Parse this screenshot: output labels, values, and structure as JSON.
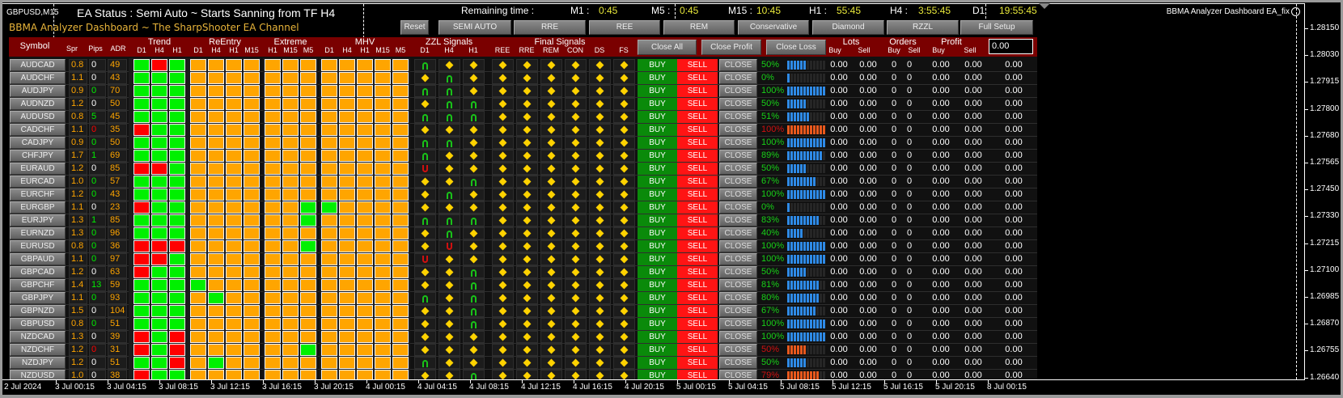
{
  "chart": {
    "symbol_tf": "GBPUSD,M15",
    "indicator_name": "BBMA Analyzer Dashboard EA_fix",
    "price_ticks": [
      "1.28150",
      "1.28030",
      "1.27915",
      "1.27800",
      "1.27680",
      "1.27565",
      "1.27450",
      "1.27330",
      "1.27215",
      "1.27100",
      "1.26985",
      "1.26870",
      "1.26755",
      "1.26640"
    ],
    "time_ticks": [
      "2 Jul 2024",
      "3 Jul 00:15",
      "3 Jul 04:15",
      "3 Jul 08:15",
      "3 Jul 12:15",
      "3 Jul 16:15",
      "3 Jul 20:15",
      "4 Jul 00:15",
      "4 Jul 04:15",
      "4 Jul 08:15",
      "4 Jul 12:15",
      "4 Jul 16:15",
      "4 Jul 20:15",
      "5 Jul 00:15",
      "5 Jul 04:15",
      "5 Jul 08:15",
      "5 Jul 12:15",
      "5 Jul 16:15",
      "5 Jul 20:15",
      "8 Jul 00:15"
    ]
  },
  "status": {
    "ea_status": "EA Status : Semi Auto ~ Starts Sanning from TF H4",
    "brand": "BBMA Analyzer Dashboard ~ The SharpShooter EA Channel"
  },
  "timer": {
    "label": "Remaining time :",
    "items": [
      {
        "tf": "M1 :",
        "value": "0:45"
      },
      {
        "tf": "M5 :",
        "value": "0:45"
      },
      {
        "tf": "M15 :",
        "value": "10:45"
      },
      {
        "tf": "H1 :",
        "value": "55:45"
      },
      {
        "tf": "H4 :",
        "value": "3:55:45"
      },
      {
        "tf": "D1",
        "value": "19:55:45"
      }
    ]
  },
  "mode_buttons": [
    "Reset",
    "SEMI AUTO",
    "RRE",
    "REE",
    "REM",
    "Conservative",
    "Diamond",
    "RZZL",
    "Full Setup"
  ],
  "columns": {
    "symbol": "Symbol",
    "spr": "Spr",
    "pips": "Pips",
    "adr": "ADR",
    "trend": {
      "label": "Trend",
      "sub": [
        "D1",
        "H4",
        "H1"
      ]
    },
    "reentry": {
      "label": "ReEntry",
      "sub": [
        "D1",
        "H4",
        "H1",
        "M15"
      ]
    },
    "extreme": {
      "label": "Extreme",
      "sub": [
        "H1",
        "M15",
        "M5"
      ]
    },
    "mhv": {
      "label": "MHV",
      "sub": [
        "D1",
        "H4",
        "H1",
        "M15",
        "M5"
      ]
    },
    "zzl": {
      "label": "ZZL Signals",
      "sub": [
        "D1",
        "H4",
        "H1"
      ]
    },
    "final": {
      "label": "Final Signals",
      "sub": [
        "REE",
        "RRE",
        "REM",
        "CON",
        "DS",
        "FS"
      ]
    },
    "lots": {
      "label": "Lots",
      "buy": "Buy",
      "sell": "Sell"
    },
    "orders": {
      "label": "Orders",
      "buy": "Buy",
      "sell": "Sell"
    },
    "profit": {
      "label": "Profit",
      "buy": "Buy",
      "sell": "Sell"
    }
  },
  "actions": {
    "close_all": "Close All",
    "close_profit": "Close Profit",
    "close_loss": "Close Loss"
  },
  "profit_total_input": "0.00",
  "row_buttons": {
    "buy": "BUY",
    "sell": "SELL",
    "close": "CLOSE"
  },
  "colors": {
    "header_bg": "#7a0000",
    "green": "#00f000",
    "red": "#ff0000",
    "orange": "#ffa500",
    "diamond": "#ffd200",
    "bar_blue": "#2e8ae6",
    "bar_orange": "#e8581c",
    "timer_value": "#e8e83a",
    "brand": "#e8b43a",
    "buy": "#0a8a0a",
    "sell": "#ff1414",
    "close": "#6c6c6c"
  },
  "rows": [
    {
      "symbol": "AUDCAD",
      "spr": "0.8",
      "pips": "0",
      "pips_color": "white",
      "adr": "49",
      "trend": [
        "green",
        "red",
        "green"
      ],
      "reentry": [
        "orange",
        "orange",
        "orange",
        "orange"
      ],
      "extreme": [
        "orange",
        "orange",
        "orange"
      ],
      "mhv": [
        "orange",
        "orange",
        "orange",
        "orange",
        "orange"
      ],
      "zzl": [
        "up",
        "diamond",
        "diamond"
      ],
      "pct": "50%",
      "pct_color": "green"
    },
    {
      "symbol": "AUDCHF",
      "spr": "1.1",
      "pips": "0",
      "pips_color": "white",
      "adr": "43",
      "trend": [
        "green",
        "green",
        "green"
      ],
      "reentry": [
        "orange",
        "orange",
        "orange",
        "orange"
      ],
      "extreme": [
        "orange",
        "orange",
        "orange"
      ],
      "mhv": [
        "orange",
        "orange",
        "orange",
        "orange",
        "orange"
      ],
      "zzl": [
        "diamond",
        "up",
        "diamond"
      ],
      "pct": "0%",
      "pct_color": "green"
    },
    {
      "symbol": "AUDJPY",
      "spr": "0.9",
      "pips": "0",
      "pips_color": "green",
      "adr": "70",
      "trend": [
        "green",
        "green",
        "green"
      ],
      "reentry": [
        "orange",
        "orange",
        "orange",
        "orange"
      ],
      "extreme": [
        "orange",
        "orange",
        "orange"
      ],
      "mhv": [
        "orange",
        "orange",
        "orange",
        "orange",
        "orange"
      ],
      "zzl": [
        "up",
        "up",
        "diamond"
      ],
      "pct": "100%",
      "pct_color": "green"
    },
    {
      "symbol": "AUDNZD",
      "spr": "1.2",
      "pips": "0",
      "pips_color": "white",
      "adr": "50",
      "trend": [
        "green",
        "green",
        "green"
      ],
      "reentry": [
        "orange",
        "orange",
        "orange",
        "orange"
      ],
      "extreme": [
        "orange",
        "orange",
        "orange"
      ],
      "mhv": [
        "orange",
        "orange",
        "orange",
        "orange",
        "orange"
      ],
      "zzl": [
        "diamond",
        "up",
        "up"
      ],
      "pct": "50%",
      "pct_color": "green"
    },
    {
      "symbol": "AUDUSD",
      "spr": "0.8",
      "pips": "5",
      "pips_color": "green",
      "adr": "45",
      "trend": [
        "green",
        "green",
        "green"
      ],
      "reentry": [
        "orange",
        "orange",
        "orange",
        "orange"
      ],
      "extreme": [
        "orange",
        "orange",
        "orange"
      ],
      "mhv": [
        "orange",
        "orange",
        "orange",
        "orange",
        "orange"
      ],
      "zzl": [
        "up",
        "up",
        "up"
      ],
      "pct": "51%",
      "pct_color": "green"
    },
    {
      "symbol": "CADCHF",
      "spr": "1.1",
      "pips": "0",
      "pips_color": "red",
      "adr": "35",
      "trend": [
        "red",
        "green",
        "green"
      ],
      "reentry": [
        "orange",
        "orange",
        "orange",
        "orange"
      ],
      "extreme": [
        "orange",
        "orange",
        "orange"
      ],
      "mhv": [
        "orange",
        "orange",
        "orange",
        "orange",
        "orange"
      ],
      "zzl": [
        "diamond",
        "diamond",
        "diamond"
      ],
      "pct": "100%",
      "pct_color": "red"
    },
    {
      "symbol": "CADJPY",
      "spr": "0.9",
      "pips": "0",
      "pips_color": "green",
      "adr": "50",
      "trend": [
        "green",
        "green",
        "green"
      ],
      "reentry": [
        "orange",
        "orange",
        "orange",
        "orange"
      ],
      "extreme": [
        "orange",
        "orange",
        "orange"
      ],
      "mhv": [
        "orange",
        "orange",
        "orange",
        "orange",
        "orange"
      ],
      "zzl": [
        "up",
        "up",
        "diamond"
      ],
      "pct": "100%",
      "pct_color": "green"
    },
    {
      "symbol": "CHFJPY",
      "spr": "1.7",
      "pips": "1",
      "pips_color": "green",
      "adr": "69",
      "trend": [
        "green",
        "green",
        "green"
      ],
      "reentry": [
        "orange",
        "orange",
        "orange",
        "orange"
      ],
      "extreme": [
        "orange",
        "orange",
        "orange"
      ],
      "mhv": [
        "orange",
        "orange",
        "orange",
        "orange",
        "orange"
      ],
      "zzl": [
        "up",
        "diamond",
        "diamond"
      ],
      "pct": "89%",
      "pct_color": "green"
    },
    {
      "symbol": "EURAUD",
      "spr": "1.2",
      "pips": "0",
      "pips_color": "white",
      "adr": "85",
      "trend": [
        "red",
        "red",
        "green"
      ],
      "reentry": [
        "orange",
        "orange",
        "orange",
        "orange"
      ],
      "extreme": [
        "orange",
        "orange",
        "orange"
      ],
      "mhv": [
        "orange",
        "orange",
        "orange",
        "orange",
        "orange"
      ],
      "zzl": [
        "down",
        "diamond",
        "diamond"
      ],
      "pct": "50%",
      "pct_color": "green"
    },
    {
      "symbol": "EURCAD",
      "spr": "1.0",
      "pips": "0",
      "pips_color": "green",
      "adr": "57",
      "trend": [
        "green",
        "green",
        "green"
      ],
      "reentry": [
        "orange",
        "orange",
        "orange",
        "orange"
      ],
      "extreme": [
        "orange",
        "orange",
        "orange"
      ],
      "mhv": [
        "orange",
        "orange",
        "orange",
        "orange",
        "orange"
      ],
      "zzl": [
        "diamond",
        "diamond",
        "up"
      ],
      "pct": "67%",
      "pct_color": "green"
    },
    {
      "symbol": "EURCHF",
      "spr": "1.2",
      "pips": "0",
      "pips_color": "green",
      "adr": "43",
      "trend": [
        "green",
        "green",
        "green"
      ],
      "reentry": [
        "orange",
        "orange",
        "orange",
        "orange"
      ],
      "extreme": [
        "orange",
        "orange",
        "orange"
      ],
      "mhv": [
        "orange",
        "orange",
        "orange",
        "orange",
        "orange"
      ],
      "zzl": [
        "diamond",
        "up",
        "diamond"
      ],
      "pct": "100%",
      "pct_color": "green"
    },
    {
      "symbol": "EURGBP",
      "spr": "1.1",
      "pips": "0",
      "pips_color": "white",
      "adr": "23",
      "trend": [
        "red",
        "green",
        "green"
      ],
      "reentry": [
        "orange",
        "orange",
        "orange",
        "orange"
      ],
      "extreme": [
        "orange",
        "orange",
        "green"
      ],
      "mhv": [
        "green",
        "orange",
        "orange",
        "orange",
        "orange"
      ],
      "zzl": [
        "diamond",
        "diamond",
        "diamond"
      ],
      "pct": "0%",
      "pct_color": "green"
    },
    {
      "symbol": "EURJPY",
      "spr": "1.3",
      "pips": "1",
      "pips_color": "green",
      "adr": "85",
      "trend": [
        "green",
        "green",
        "green"
      ],
      "reentry": [
        "orange",
        "orange",
        "orange",
        "orange"
      ],
      "extreme": [
        "orange",
        "orange",
        "green"
      ],
      "mhv": [
        "orange",
        "orange",
        "orange",
        "orange",
        "orange"
      ],
      "zzl": [
        "up",
        "up",
        "up"
      ],
      "pct": "83%",
      "pct_color": "green"
    },
    {
      "symbol": "EURNZD",
      "spr": "1.3",
      "pips": "0",
      "pips_color": "green",
      "adr": "96",
      "trend": [
        "green",
        "green",
        "green"
      ],
      "reentry": [
        "orange",
        "orange",
        "orange",
        "orange"
      ],
      "extreme": [
        "orange",
        "orange",
        "orange"
      ],
      "mhv": [
        "orange",
        "orange",
        "orange",
        "orange",
        "orange"
      ],
      "zzl": [
        "diamond",
        "up",
        "diamond"
      ],
      "pct": "40%",
      "pct_color": "green"
    },
    {
      "symbol": "EURUSD",
      "spr": "0.8",
      "pips": "0",
      "pips_color": "green",
      "adr": "36",
      "trend": [
        "red",
        "red",
        "red"
      ],
      "reentry": [
        "orange",
        "orange",
        "orange",
        "orange"
      ],
      "extreme": [
        "orange",
        "orange",
        "green"
      ],
      "mhv": [
        "orange",
        "orange",
        "orange",
        "orange",
        "orange"
      ],
      "zzl": [
        "diamond",
        "down",
        "diamond"
      ],
      "pct": "100%",
      "pct_color": "green"
    },
    {
      "symbol": "GBPAUD",
      "spr": "1.1",
      "pips": "0",
      "pips_color": "green",
      "adr": "97",
      "trend": [
        "red",
        "red",
        "green"
      ],
      "reentry": [
        "orange",
        "orange",
        "orange",
        "orange"
      ],
      "extreme": [
        "orange",
        "orange",
        "orange"
      ],
      "mhv": [
        "orange",
        "orange",
        "orange",
        "orange",
        "orange"
      ],
      "zzl": [
        "down",
        "diamond",
        "diamond"
      ],
      "pct": "100%",
      "pct_color": "green"
    },
    {
      "symbol": "GBPCAD",
      "spr": "1.2",
      "pips": "0",
      "pips_color": "white",
      "adr": "63",
      "trend": [
        "red",
        "green",
        "green"
      ],
      "reentry": [
        "orange",
        "orange",
        "orange",
        "orange"
      ],
      "extreme": [
        "orange",
        "orange",
        "orange"
      ],
      "mhv": [
        "orange",
        "orange",
        "orange",
        "orange",
        "orange"
      ],
      "zzl": [
        "diamond",
        "diamond",
        "up"
      ],
      "pct": "50%",
      "pct_color": "green"
    },
    {
      "symbol": "GBPCHF",
      "spr": "1.4",
      "pips": "13",
      "pips_color": "green",
      "adr": "59",
      "trend": [
        "green",
        "green",
        "green"
      ],
      "reentry": [
        "green",
        "orange",
        "orange",
        "orange"
      ],
      "extreme": [
        "orange",
        "orange",
        "orange"
      ],
      "mhv": [
        "orange",
        "orange",
        "orange",
        "orange",
        "orange"
      ],
      "zzl": [
        "diamond",
        "diamond",
        "up"
      ],
      "pct": "81%",
      "pct_color": "green"
    },
    {
      "symbol": "GBPJPY",
      "spr": "1.1",
      "pips": "0",
      "pips_color": "green",
      "adr": "93",
      "trend": [
        "green",
        "green",
        "green"
      ],
      "reentry": [
        "orange",
        "green",
        "orange",
        "orange"
      ],
      "extreme": [
        "orange",
        "orange",
        "orange"
      ],
      "mhv": [
        "orange",
        "orange",
        "orange",
        "orange",
        "orange"
      ],
      "zzl": [
        "up",
        "diamond",
        "up"
      ],
      "pct": "80%",
      "pct_color": "green"
    },
    {
      "symbol": "GBPNZD",
      "spr": "1.5",
      "pips": "0",
      "pips_color": "white",
      "adr": "104",
      "trend": [
        "green",
        "green",
        "green"
      ],
      "reentry": [
        "orange",
        "orange",
        "orange",
        "orange"
      ],
      "extreme": [
        "orange",
        "orange",
        "orange"
      ],
      "mhv": [
        "orange",
        "orange",
        "orange",
        "orange",
        "orange"
      ],
      "zzl": [
        "diamond",
        "diamond",
        "up"
      ],
      "pct": "67%",
      "pct_color": "green"
    },
    {
      "symbol": "GBPUSD",
      "spr": "0.8",
      "pips": "0",
      "pips_color": "green",
      "adr": "51",
      "trend": [
        "green",
        "green",
        "green"
      ],
      "reentry": [
        "orange",
        "orange",
        "orange",
        "orange"
      ],
      "extreme": [
        "orange",
        "orange",
        "orange"
      ],
      "mhv": [
        "orange",
        "orange",
        "orange",
        "orange",
        "orange"
      ],
      "zzl": [
        "diamond",
        "diamond",
        "up"
      ],
      "pct": "100%",
      "pct_color": "green"
    },
    {
      "symbol": "NZDCAD",
      "spr": "1.3",
      "pips": "0",
      "pips_color": "white",
      "adr": "39",
      "trend": [
        "red",
        "green",
        "red"
      ],
      "reentry": [
        "orange",
        "orange",
        "orange",
        "orange"
      ],
      "extreme": [
        "orange",
        "orange",
        "orange"
      ],
      "mhv": [
        "orange",
        "orange",
        "orange",
        "orange",
        "orange"
      ],
      "zzl": [
        "diamond",
        "diamond",
        "diamond"
      ],
      "pct": "100%",
      "pct_color": "green"
    },
    {
      "symbol": "NZDCHF",
      "spr": "1.2",
      "pips": "0",
      "pips_color": "red",
      "adr": "31",
      "trend": [
        "red",
        "green",
        "red"
      ],
      "reentry": [
        "orange",
        "orange",
        "orange",
        "orange"
      ],
      "extreme": [
        "orange",
        "orange",
        "green"
      ],
      "mhv": [
        "orange",
        "orange",
        "orange",
        "orange",
        "orange"
      ],
      "zzl": [
        "diamond",
        "diamond",
        "diamond"
      ],
      "pct": "50%",
      "pct_color": "red"
    },
    {
      "symbol": "NZDJPY",
      "spr": "1.2",
      "pips": "0",
      "pips_color": "white",
      "adr": "51",
      "trend": [
        "green",
        "green",
        "red"
      ],
      "reentry": [
        "orange",
        "green",
        "orange",
        "orange"
      ],
      "extreme": [
        "orange",
        "orange",
        "orange"
      ],
      "mhv": [
        "orange",
        "orange",
        "orange",
        "orange",
        "orange"
      ],
      "zzl": [
        "up",
        "diamond",
        "diamond"
      ],
      "pct": "50%",
      "pct_color": "green"
    },
    {
      "symbol": "NZDUSD",
      "spr": "1.0",
      "pips": "0",
      "pips_color": "white",
      "adr": "38",
      "trend": [
        "red",
        "green",
        "green"
      ],
      "reentry": [
        "orange",
        "orange",
        "orange",
        "orange"
      ],
      "extreme": [
        "orange",
        "orange",
        "orange"
      ],
      "mhv": [
        "orange",
        "orange",
        "orange",
        "orange",
        "orange"
      ],
      "zzl": [
        "diamond",
        "diamond",
        "up"
      ],
      "pct": "79%",
      "pct_color": "red"
    }
  ],
  "row_defaults": {
    "final": [
      "diamond",
      "diamond",
      "diamond",
      "diamond",
      "diamond",
      "diamond"
    ],
    "lots_buy": "0.00",
    "lots_sell": "0.00",
    "orders_buy": "0",
    "orders_sell": "0",
    "profit_buy": "0.00",
    "profit_sell": "0.00",
    "total": "0.00"
  }
}
